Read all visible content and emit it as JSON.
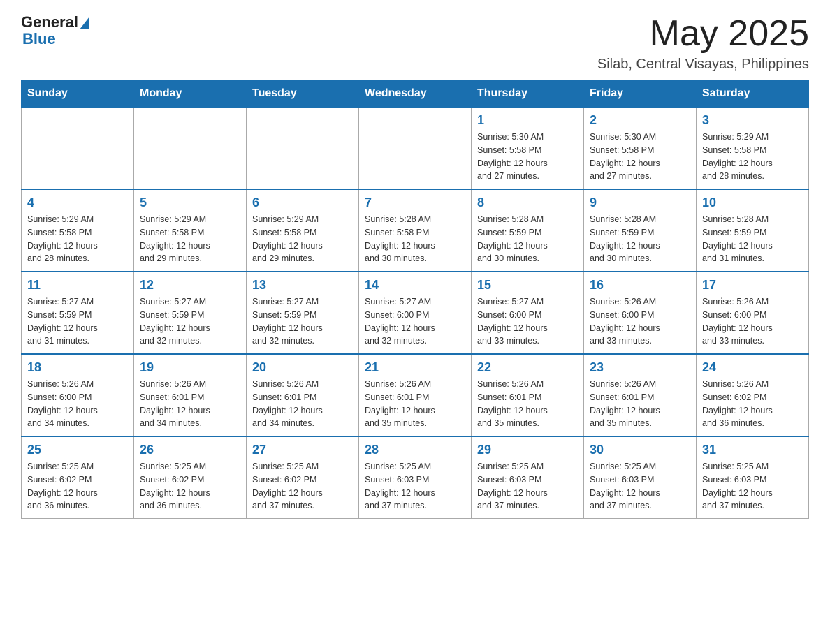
{
  "header": {
    "logo": {
      "general": "General",
      "blue": "Blue"
    },
    "month": "May 2025",
    "location": "Silab, Central Visayas, Philippines"
  },
  "weekdays": [
    "Sunday",
    "Monday",
    "Tuesday",
    "Wednesday",
    "Thursday",
    "Friday",
    "Saturday"
  ],
  "weeks": [
    [
      {
        "day": "",
        "info": ""
      },
      {
        "day": "",
        "info": ""
      },
      {
        "day": "",
        "info": ""
      },
      {
        "day": "",
        "info": ""
      },
      {
        "day": "1",
        "info": "Sunrise: 5:30 AM\nSunset: 5:58 PM\nDaylight: 12 hours\nand 27 minutes."
      },
      {
        "day": "2",
        "info": "Sunrise: 5:30 AM\nSunset: 5:58 PM\nDaylight: 12 hours\nand 27 minutes."
      },
      {
        "day": "3",
        "info": "Sunrise: 5:29 AM\nSunset: 5:58 PM\nDaylight: 12 hours\nand 28 minutes."
      }
    ],
    [
      {
        "day": "4",
        "info": "Sunrise: 5:29 AM\nSunset: 5:58 PM\nDaylight: 12 hours\nand 28 minutes."
      },
      {
        "day": "5",
        "info": "Sunrise: 5:29 AM\nSunset: 5:58 PM\nDaylight: 12 hours\nand 29 minutes."
      },
      {
        "day": "6",
        "info": "Sunrise: 5:29 AM\nSunset: 5:58 PM\nDaylight: 12 hours\nand 29 minutes."
      },
      {
        "day": "7",
        "info": "Sunrise: 5:28 AM\nSunset: 5:58 PM\nDaylight: 12 hours\nand 30 minutes."
      },
      {
        "day": "8",
        "info": "Sunrise: 5:28 AM\nSunset: 5:59 PM\nDaylight: 12 hours\nand 30 minutes."
      },
      {
        "day": "9",
        "info": "Sunrise: 5:28 AM\nSunset: 5:59 PM\nDaylight: 12 hours\nand 30 minutes."
      },
      {
        "day": "10",
        "info": "Sunrise: 5:28 AM\nSunset: 5:59 PM\nDaylight: 12 hours\nand 31 minutes."
      }
    ],
    [
      {
        "day": "11",
        "info": "Sunrise: 5:27 AM\nSunset: 5:59 PM\nDaylight: 12 hours\nand 31 minutes."
      },
      {
        "day": "12",
        "info": "Sunrise: 5:27 AM\nSunset: 5:59 PM\nDaylight: 12 hours\nand 32 minutes."
      },
      {
        "day": "13",
        "info": "Sunrise: 5:27 AM\nSunset: 5:59 PM\nDaylight: 12 hours\nand 32 minutes."
      },
      {
        "day": "14",
        "info": "Sunrise: 5:27 AM\nSunset: 6:00 PM\nDaylight: 12 hours\nand 32 minutes."
      },
      {
        "day": "15",
        "info": "Sunrise: 5:27 AM\nSunset: 6:00 PM\nDaylight: 12 hours\nand 33 minutes."
      },
      {
        "day": "16",
        "info": "Sunrise: 5:26 AM\nSunset: 6:00 PM\nDaylight: 12 hours\nand 33 minutes."
      },
      {
        "day": "17",
        "info": "Sunrise: 5:26 AM\nSunset: 6:00 PM\nDaylight: 12 hours\nand 33 minutes."
      }
    ],
    [
      {
        "day": "18",
        "info": "Sunrise: 5:26 AM\nSunset: 6:00 PM\nDaylight: 12 hours\nand 34 minutes."
      },
      {
        "day": "19",
        "info": "Sunrise: 5:26 AM\nSunset: 6:01 PM\nDaylight: 12 hours\nand 34 minutes."
      },
      {
        "day": "20",
        "info": "Sunrise: 5:26 AM\nSunset: 6:01 PM\nDaylight: 12 hours\nand 34 minutes."
      },
      {
        "day": "21",
        "info": "Sunrise: 5:26 AM\nSunset: 6:01 PM\nDaylight: 12 hours\nand 35 minutes."
      },
      {
        "day": "22",
        "info": "Sunrise: 5:26 AM\nSunset: 6:01 PM\nDaylight: 12 hours\nand 35 minutes."
      },
      {
        "day": "23",
        "info": "Sunrise: 5:26 AM\nSunset: 6:01 PM\nDaylight: 12 hours\nand 35 minutes."
      },
      {
        "day": "24",
        "info": "Sunrise: 5:26 AM\nSunset: 6:02 PM\nDaylight: 12 hours\nand 36 minutes."
      }
    ],
    [
      {
        "day": "25",
        "info": "Sunrise: 5:25 AM\nSunset: 6:02 PM\nDaylight: 12 hours\nand 36 minutes."
      },
      {
        "day": "26",
        "info": "Sunrise: 5:25 AM\nSunset: 6:02 PM\nDaylight: 12 hours\nand 36 minutes."
      },
      {
        "day": "27",
        "info": "Sunrise: 5:25 AM\nSunset: 6:02 PM\nDaylight: 12 hours\nand 37 minutes."
      },
      {
        "day": "28",
        "info": "Sunrise: 5:25 AM\nSunset: 6:03 PM\nDaylight: 12 hours\nand 37 minutes."
      },
      {
        "day": "29",
        "info": "Sunrise: 5:25 AM\nSunset: 6:03 PM\nDaylight: 12 hours\nand 37 minutes."
      },
      {
        "day": "30",
        "info": "Sunrise: 5:25 AM\nSunset: 6:03 PM\nDaylight: 12 hours\nand 37 minutes."
      },
      {
        "day": "31",
        "info": "Sunrise: 5:25 AM\nSunset: 6:03 PM\nDaylight: 12 hours\nand 37 minutes."
      }
    ]
  ]
}
